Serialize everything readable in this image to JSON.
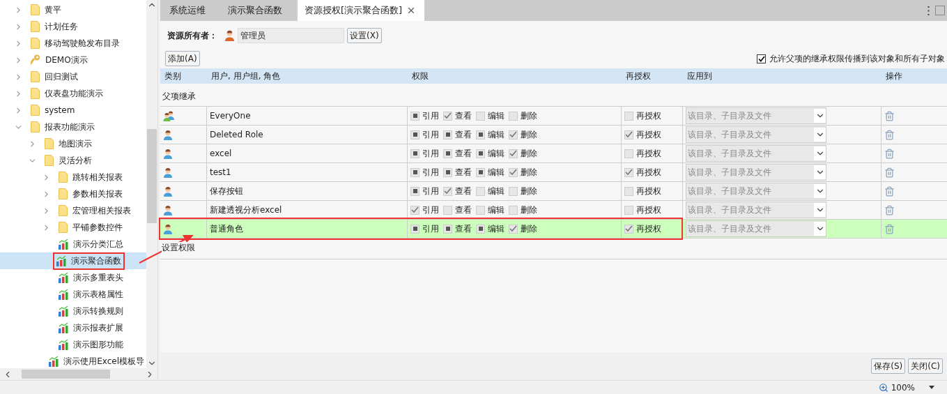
{
  "sidebar": {
    "tree": [
      {
        "label": "黄平",
        "kind": "folder",
        "expanded": false,
        "selected": false
      },
      {
        "label": "计划任务",
        "kind": "folder",
        "expanded": false,
        "selected": false
      },
      {
        "label": "移动驾驶舱发布目录",
        "kind": "folder",
        "expanded": false,
        "selected": false
      },
      {
        "label": "DEMO演示",
        "kind": "key",
        "expanded": false,
        "selected": false
      },
      {
        "label": "回归测试",
        "kind": "folder",
        "expanded": false,
        "selected": false
      },
      {
        "label": "仪表盘功能演示",
        "kind": "folder",
        "expanded": false,
        "selected": false
      },
      {
        "label": "system",
        "kind": "folder",
        "expanded": false,
        "selected": false
      },
      {
        "label": "报表功能演示",
        "kind": "folder",
        "expanded": true,
        "selected": false,
        "children": [
          {
            "label": "地图演示",
            "kind": "folder",
            "expanded": false,
            "selected": false
          },
          {
            "label": "灵活分析",
            "kind": "folder",
            "expanded": true,
            "selected": false,
            "children": [
              {
                "label": "跳转相关报表",
                "kind": "folder",
                "expanded": false,
                "selected": false
              },
              {
                "label": "参数相关报表",
                "kind": "folder",
                "expanded": false,
                "selected": false
              },
              {
                "label": "宏管理相关报表",
                "kind": "folder",
                "expanded": false,
                "selected": false
              },
              {
                "label": "平铺参数控件",
                "kind": "folder",
                "expanded": false,
                "selected": false
              },
              {
                "label": "演示分类汇总",
                "kind": "report",
                "selected": false
              },
              {
                "label": "演示聚合函数",
                "kind": "report",
                "selected": true
              },
              {
                "label": "演示多重表头",
                "kind": "report",
                "selected": false
              },
              {
                "label": "演示表格属性",
                "kind": "report",
                "selected": false
              },
              {
                "label": "演示转换规则",
                "kind": "report",
                "selected": false
              },
              {
                "label": "演示报表扩展",
                "kind": "report",
                "selected": false
              },
              {
                "label": "演示图形功能",
                "kind": "report",
                "selected": false
              },
              {
                "label": "演示使用Excel模板导",
                "kind": "report",
                "selected": false
              }
            ]
          }
        ]
      }
    ]
  },
  "tabs": [
    {
      "label": "系统运维",
      "selected": false,
      "closable": false
    },
    {
      "label": "演示聚合函数",
      "selected": false,
      "closable": false
    },
    {
      "label": "资源授权[演示聚合函数]",
      "selected": true,
      "closable": true
    }
  ],
  "owner": {
    "label": "资源所有者：",
    "value": "管理员",
    "button": "设置(X)"
  },
  "add_button": "添加(A)",
  "propagate": {
    "label": "允许父项的继承权限传播到该对象和所有子对象",
    "checked": true
  },
  "table": {
    "columns": [
      "类别",
      "用户, 用户组, 角色",
      "权限",
      "再授权",
      "应用到",
      "操作"
    ],
    "section": "父项继承",
    "rows": [
      {
        "kind": "group",
        "name": "EveryOne",
        "selected": false,
        "permissions": [
          {
            "label": "引用",
            "checked": true,
            "inherited": true
          },
          {
            "label": "查看",
            "checked": true,
            "inherited": false
          },
          {
            "label": "编辑",
            "checked": false
          },
          {
            "label": "删除",
            "checked": false
          }
        ],
        "reauthorize": {
          "label": "再授权",
          "checked": false
        },
        "apply_to": "该目录、子目录及文件"
      },
      {
        "kind": "user",
        "name": "Deleted Role",
        "selected": false,
        "permissions": [
          {
            "label": "引用",
            "checked": true,
            "inherited": true
          },
          {
            "label": "查看",
            "checked": true,
            "inherited": true
          },
          {
            "label": "编辑",
            "checked": true,
            "inherited": true
          },
          {
            "label": "删除",
            "checked": true,
            "inherited": false
          }
        ],
        "reauthorize": {
          "label": "再授权",
          "checked": true,
          "inherited": false
        },
        "apply_to": "该目录、子目录及文件"
      },
      {
        "kind": "user",
        "name": "excel",
        "selected": false,
        "permissions": [
          {
            "label": "引用",
            "checked": true,
            "inherited": true
          },
          {
            "label": "查看",
            "checked": true,
            "inherited": true
          },
          {
            "label": "编辑",
            "checked": true,
            "inherited": true
          },
          {
            "label": "删除",
            "checked": true,
            "inherited": false
          }
        ],
        "reauthorize": {
          "label": "再授权",
          "checked": false
        },
        "apply_to": "该目录、子目录及文件"
      },
      {
        "kind": "user",
        "name": "test1",
        "selected": false,
        "permissions": [
          {
            "label": "引用",
            "checked": true,
            "inherited": true
          },
          {
            "label": "查看",
            "checked": true,
            "inherited": true
          },
          {
            "label": "编辑",
            "checked": true,
            "inherited": true
          },
          {
            "label": "删除",
            "checked": true,
            "inherited": false
          }
        ],
        "reauthorize": {
          "label": "再授权",
          "checked": true,
          "inherited": false
        },
        "apply_to": "该目录、子目录及文件"
      },
      {
        "kind": "user",
        "name": "保存按钮",
        "selected": false,
        "permissions": [
          {
            "label": "引用",
            "checked": true,
            "inherited": true
          },
          {
            "label": "查看",
            "checked": true,
            "inherited": false
          },
          {
            "label": "编辑",
            "checked": false
          },
          {
            "label": "删除",
            "checked": false
          }
        ],
        "reauthorize": {
          "label": "再授权",
          "checked": false
        },
        "apply_to": "该目录、子目录及文件"
      },
      {
        "kind": "user",
        "name": "新建透视分析excel",
        "selected": false,
        "permissions": [
          {
            "label": "引用",
            "checked": true,
            "inherited": false
          },
          {
            "label": "查看",
            "checked": false
          },
          {
            "label": "编辑",
            "checked": false
          },
          {
            "label": "删除",
            "checked": false
          }
        ],
        "reauthorize": {
          "label": "再授权",
          "checked": false
        },
        "apply_to": "该目录、子目录及文件"
      },
      {
        "kind": "user",
        "name": "普通角色",
        "selected": true,
        "permissions": [
          {
            "label": "引用",
            "checked": true,
            "inherited": true
          },
          {
            "label": "查看",
            "checked": true,
            "inherited": true
          },
          {
            "label": "编辑",
            "checked": true,
            "inherited": true
          },
          {
            "label": "删除",
            "checked": true,
            "inherited": false
          }
        ],
        "reauthorize": {
          "label": "再授权",
          "checked": true,
          "inherited": false
        },
        "apply_to": "该目录、子目录及文件"
      }
    ],
    "footer_section": "设置权限"
  },
  "buttons": [
    "保存(S)",
    "关闭(C)"
  ],
  "status_bar": {
    "zoom": "100%"
  }
}
